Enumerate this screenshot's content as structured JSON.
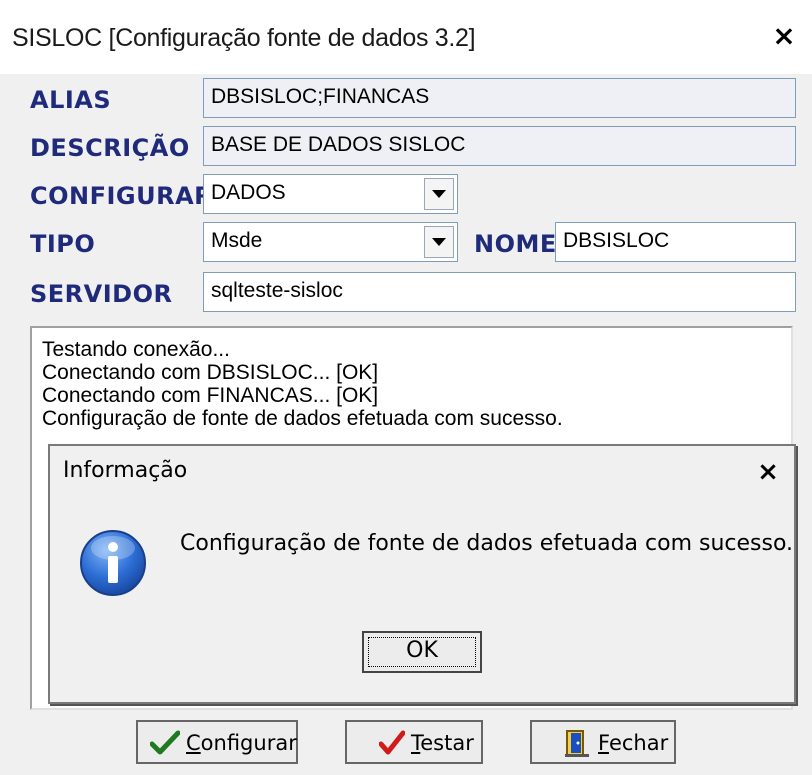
{
  "window": {
    "title": "SISLOC [Configuração fonte de dados 3.2]",
    "close_glyph": "×"
  },
  "form": {
    "alias_label": "ALIAS",
    "alias_value": "DBSISLOC;FINANCAS",
    "descricao_label": "DESCRIÇÃO",
    "descricao_value": "BASE DE DADOS SISLOC",
    "configurar_label": "CONFIGURAR",
    "configurar_value": "DADOS",
    "tipo_label": "TIPO",
    "tipo_value": "Msde",
    "nome_label": "NOME",
    "nome_value": "DBSISLOC",
    "servidor_label": "SERVIDOR",
    "servidor_value": "sqlteste-sisloc"
  },
  "log": {
    "lines": [
      "Testando conexão...",
      "Conectando com DBSISLOC... [OK]",
      "Conectando com FINANCAS... [OK]",
      "Configuração de fonte de dados efetuada com sucesso."
    ]
  },
  "dialog": {
    "title": "Informação",
    "close_glyph": "×",
    "message": "Configuração de fonte de dados efetuada com sucesso.",
    "ok_label": "OK",
    "icon": "info-icon"
  },
  "buttons": {
    "configurar_accel": "C",
    "configurar_rest": "onfigurar",
    "testar_accel": "T",
    "testar_rest": "estar",
    "fechar_accel": "F",
    "fechar_rest": "echar"
  },
  "colors": {
    "label_blue": "#1f2b7a",
    "readonly_field": "#eef0f5",
    "window_bg": "#f0f0f0"
  }
}
